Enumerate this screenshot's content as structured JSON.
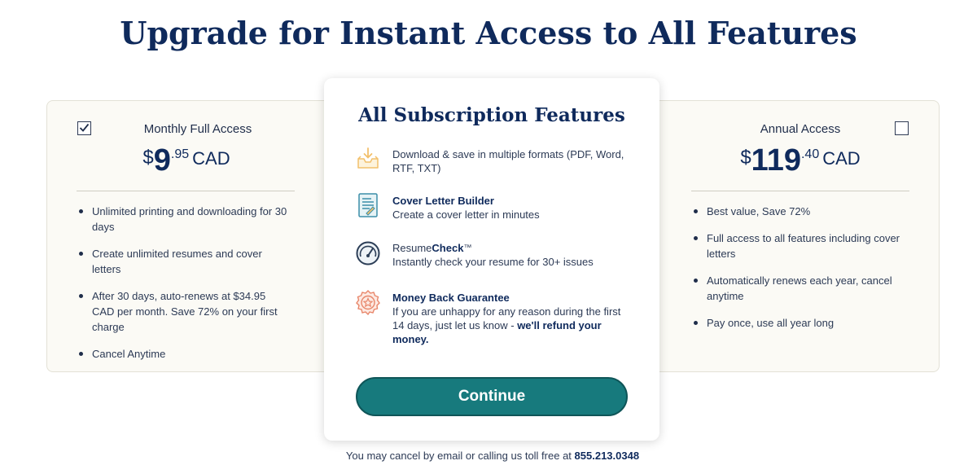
{
  "page": {
    "title": "Upgrade for Instant Access to All Features"
  },
  "monthly": {
    "name": "Monthly Full Access",
    "selected": true,
    "price": {
      "currency": "$",
      "whole": "9",
      "cents": ".95",
      "code": "CAD"
    },
    "bullets": [
      "Unlimited printing and downloading for 30 days",
      "Create unlimited resumes and cover letters",
      "After 30 days, auto-renews at $34.95 CAD per month. Save 72% on your first charge",
      "Cancel Anytime"
    ]
  },
  "annual": {
    "name": "Annual Access",
    "selected": false,
    "price": {
      "currency": "$",
      "whole": "119",
      "cents": ".40",
      "code": "CAD"
    },
    "bullets": [
      "Best value, Save 72%",
      "Full access to all features including cover letters",
      "Automatically renews each year, cancel anytime",
      "Pay once, use all year long"
    ]
  },
  "features": {
    "heading": "All Subscription Features",
    "items": [
      {
        "icon": "download-tray-icon",
        "title": "",
        "text": "Download & save in multiple formats (PDF, Word, RTF, TXT)"
      },
      {
        "icon": "document-icon",
        "title": "Cover Letter Builder",
        "text": "Create a cover letter in minutes"
      },
      {
        "icon": "gauge-icon",
        "title_plain": "Resume",
        "title_bold": "Check",
        "title_tm": "™",
        "text": "Instantly check your resume for 30+ issues"
      },
      {
        "icon": "badge-star-icon",
        "title": "Money Back Guarantee",
        "text": "If you are unhappy for any reason during the first 14 days, just let us know - ",
        "text_bold": "we'll refund your money."
      }
    ],
    "button": "Continue"
  },
  "footer": {
    "text": "You may cancel by email or calling us toll free at ",
    "phone": "855.213.0348"
  },
  "colors": {
    "navy": "#0f2a5c",
    "teal": "#177a7d",
    "orange": "#e8866a",
    "gold": "#f2c06b",
    "card_bg": "#fbfaf5"
  }
}
